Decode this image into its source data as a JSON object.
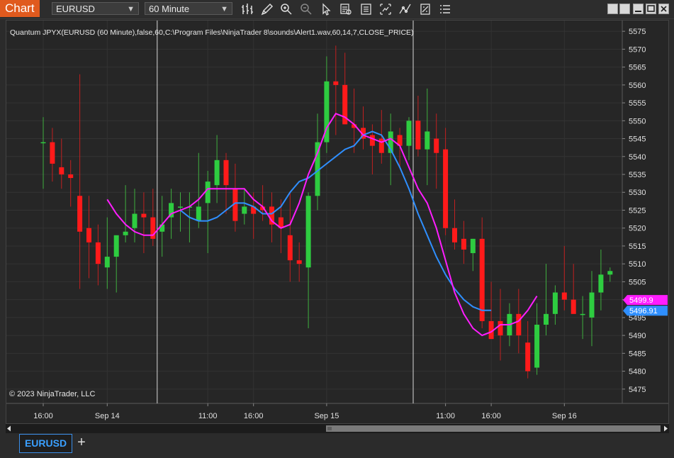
{
  "app": {
    "title": "Chart"
  },
  "toolbar": {
    "instrument": "EURUSD",
    "interval": "60 Minute",
    "icons": [
      "bar-chart-icon",
      "pencil-icon",
      "zoom-in-icon",
      "zoom-out-icon",
      "cursor-icon",
      "data-box-icon",
      "properties-icon",
      "strategies-icon",
      "indicators-icon",
      "templates-icon",
      "list-icon"
    ]
  },
  "chart": {
    "indicator_label": "Quantum JPYX(EURUSD (60 Minute),false,60,C:\\Program Files\\NinjaTrader 8\\sounds\\Alert1.wav,60,14,7,CLOSE_PRICE)",
    "copyright": "© 2023 NinjaTrader, LLC",
    "colors": {
      "up": "#2ecc40",
      "down": "#ff1a1a",
      "wick": "#9a9a9a",
      "fast": "#ff1dff",
      "slow": "#2f8fff"
    }
  },
  "chart_data": {
    "type": "candlestick",
    "ylim": [
      5471,
      5578
    ],
    "yticks": [
      5475,
      5480,
      5485,
      5490,
      5495,
      5500,
      5505,
      5510,
      5515,
      5520,
      5525,
      5530,
      5535,
      5540,
      5545,
      5550,
      5555,
      5560,
      5565,
      5570,
      5575
    ],
    "xtick_labels": [
      {
        "i": 0,
        "label": "16:00"
      },
      {
        "i": 7,
        "label": "Sep 14"
      },
      {
        "i": 18,
        "label": "11:00"
      },
      {
        "i": 23,
        "label": "16:00"
      },
      {
        "i": 31,
        "label": "Sep 15"
      },
      {
        "i": 44,
        "label": "11:00"
      },
      {
        "i": 49,
        "label": "16:00"
      },
      {
        "i": 57,
        "label": "Sep 16"
      }
    ],
    "session_breaks": [
      12,
      40
    ],
    "candles": [
      {
        "o": 5544,
        "h": 5551,
        "l": 5531,
        "c": 5544
      },
      {
        "o": 5544,
        "h": 5548,
        "l": 5533,
        "c": 5538
      },
      {
        "o": 5537,
        "h": 5545,
        "l": 5531,
        "c": 5535
      },
      {
        "o": 5535,
        "h": 5539,
        "l": 5526,
        "c": 5534
      },
      {
        "o": 5529,
        "h": 5563,
        "l": 5503,
        "c": 5519
      },
      {
        "o": 5520,
        "h": 5529,
        "l": 5506,
        "c": 5516
      },
      {
        "o": 5516,
        "h": 5521,
        "l": 5504,
        "c": 5510
      },
      {
        "o": 5509,
        "h": 5523,
        "l": 5503,
        "c": 5512
      },
      {
        "o": 5512,
        "h": 5517,
        "l": 5502,
        "c": 5518
      },
      {
        "o": 5518,
        "h": 5532,
        "l": 5516,
        "c": 5519
      },
      {
        "o": 5520,
        "h": 5531,
        "l": 5516,
        "c": 5524
      },
      {
        "o": 5524,
        "h": 5530,
        "l": 5513,
        "c": 5523
      },
      {
        "o": 5523,
        "h": 5531,
        "l": 5515,
        "c": 5517
      },
      {
        "o": 5519,
        "h": 5529,
        "l": 5512,
        "c": 5521
      },
      {
        "o": 5523,
        "h": 5531,
        "l": 5517,
        "c": 5527
      },
      {
        "o": 5526,
        "h": 5530,
        "l": 5519,
        "c": 5526
      },
      {
        "o": 5526,
        "h": 5530,
        "l": 5516,
        "c": 5526
      },
      {
        "o": 5522,
        "h": 5541,
        "l": 5520,
        "c": 5526
      },
      {
        "o": 5527,
        "h": 5536,
        "l": 5513,
        "c": 5533
      },
      {
        "o": 5532,
        "h": 5546,
        "l": 5527,
        "c": 5539
      },
      {
        "o": 5539,
        "h": 5541,
        "l": 5524,
        "c": 5532
      },
      {
        "o": 5531,
        "h": 5538,
        "l": 5519,
        "c": 5522
      },
      {
        "o": 5524,
        "h": 5531,
        "l": 5521,
        "c": 5526
      },
      {
        "o": 5526,
        "h": 5530,
        "l": 5517,
        "c": 5524
      },
      {
        "o": 5526,
        "h": 5532,
        "l": 5522,
        "c": 5525
      },
      {
        "o": 5526,
        "h": 5530,
        "l": 5516,
        "c": 5521
      },
      {
        "o": 5523,
        "h": 5528,
        "l": 5513,
        "c": 5520
      },
      {
        "o": 5518,
        "h": 5530,
        "l": 5505,
        "c": 5511
      },
      {
        "o": 5511,
        "h": 5516,
        "l": 5505,
        "c": 5510
      },
      {
        "o": 5509,
        "h": 5530,
        "l": 5492,
        "c": 5529
      },
      {
        "o": 5529,
        "h": 5552,
        "l": 5525,
        "c": 5544
      },
      {
        "o": 5544,
        "h": 5568,
        "l": 5541,
        "c": 5561
      },
      {
        "o": 5561,
        "h": 5571,
        "l": 5546,
        "c": 5560
      },
      {
        "o": 5560,
        "h": 5569,
        "l": 5549,
        "c": 5549
      },
      {
        "o": 5549,
        "h": 5559,
        "l": 5541,
        "c": 5548
      },
      {
        "o": 5548,
        "h": 5554,
        "l": 5542,
        "c": 5545
      },
      {
        "o": 5546,
        "h": 5549,
        "l": 5535,
        "c": 5543
      },
      {
        "o": 5545,
        "h": 5553,
        "l": 5538,
        "c": 5541
      },
      {
        "o": 5541,
        "h": 5552,
        "l": 5532,
        "c": 5547
      },
      {
        "o": 5546,
        "h": 5548,
        "l": 5537,
        "c": 5543
      },
      {
        "o": 5543,
        "h": 5551,
        "l": 5539,
        "c": 5550
      },
      {
        "o": 5550,
        "h": 5557,
        "l": 5540,
        "c": 5542
      },
      {
        "o": 5542,
        "h": 5559,
        "l": 5532,
        "c": 5547
      },
      {
        "o": 5545,
        "h": 5552,
        "l": 5531,
        "c": 5541
      },
      {
        "o": 5542,
        "h": 5548,
        "l": 5518,
        "c": 5520
      },
      {
        "o": 5520,
        "h": 5528,
        "l": 5514,
        "c": 5516
      },
      {
        "o": 5517,
        "h": 5522,
        "l": 5510,
        "c": 5514
      },
      {
        "o": 5513,
        "h": 5517,
        "l": 5508,
        "c": 5517
      },
      {
        "o": 5517,
        "h": 5523,
        "l": 5492,
        "c": 5494
      },
      {
        "o": 5494,
        "h": 5505,
        "l": 5490,
        "c": 5489
      },
      {
        "o": 5494,
        "h": 5503,
        "l": 5483,
        "c": 5490
      },
      {
        "o": 5490,
        "h": 5499,
        "l": 5487,
        "c": 5496
      },
      {
        "o": 5496,
        "h": 5503,
        "l": 5485,
        "c": 5490
      },
      {
        "o": 5488,
        "h": 5494,
        "l": 5478,
        "c": 5480
      },
      {
        "o": 5481,
        "h": 5499,
        "l": 5479,
        "c": 5493
      },
      {
        "o": 5493,
        "h": 5510,
        "l": 5490,
        "c": 5496
      },
      {
        "o": 5496,
        "h": 5504,
        "l": 5493,
        "c": 5502
      },
      {
        "o": 5502,
        "h": 5515,
        "l": 5497,
        "c": 5500
      },
      {
        "o": 5500,
        "h": 5510,
        "l": 5497,
        "c": 5496
      },
      {
        "o": 5496,
        "h": 5501,
        "l": 5489,
        "c": 5496
      },
      {
        "o": 5495,
        "h": 5508,
        "l": 5487,
        "c": 5502
      },
      {
        "o": 5502,
        "h": 5514,
        "l": 5497,
        "c": 5507
      },
      {
        "o": 5507,
        "h": 5509,
        "l": 5505,
        "c": 5508
      }
    ],
    "fast_line": {
      "start": 7,
      "values": [
        5528,
        5524,
        5521,
        5519,
        5518,
        5518,
        5521,
        5524,
        5525,
        5526,
        5528,
        5531,
        5531,
        5531,
        5531,
        5531,
        5528,
        5526,
        5522,
        5520,
        5521,
        5527,
        5535,
        5541,
        5548,
        5552,
        5551,
        5549,
        5546,
        5545,
        5544,
        5545,
        5543,
        5537,
        5531,
        5527,
        5520,
        5511,
        5502,
        5496,
        5492,
        5490,
        5491,
        5493,
        5493,
        5494,
        5497,
        5501
      ]
    },
    "slow_line": {
      "start": 15,
      "values": [
        5525,
        5523,
        5522,
        5522,
        5523,
        5525,
        5527,
        5527,
        5526,
        5524,
        5524,
        5526,
        5530,
        5533,
        5534,
        5536,
        5538,
        5540,
        5542,
        5543,
        5546,
        5547,
        5546,
        5542,
        5537,
        5531,
        5524,
        5518,
        5512,
        5507,
        5503,
        5500,
        5498,
        5497,
        5497
      ]
    },
    "price_labels": [
      {
        "value": "5499.9",
        "series": "fast"
      },
      {
        "value": "5496.91",
        "series": "slow"
      }
    ]
  }
}
